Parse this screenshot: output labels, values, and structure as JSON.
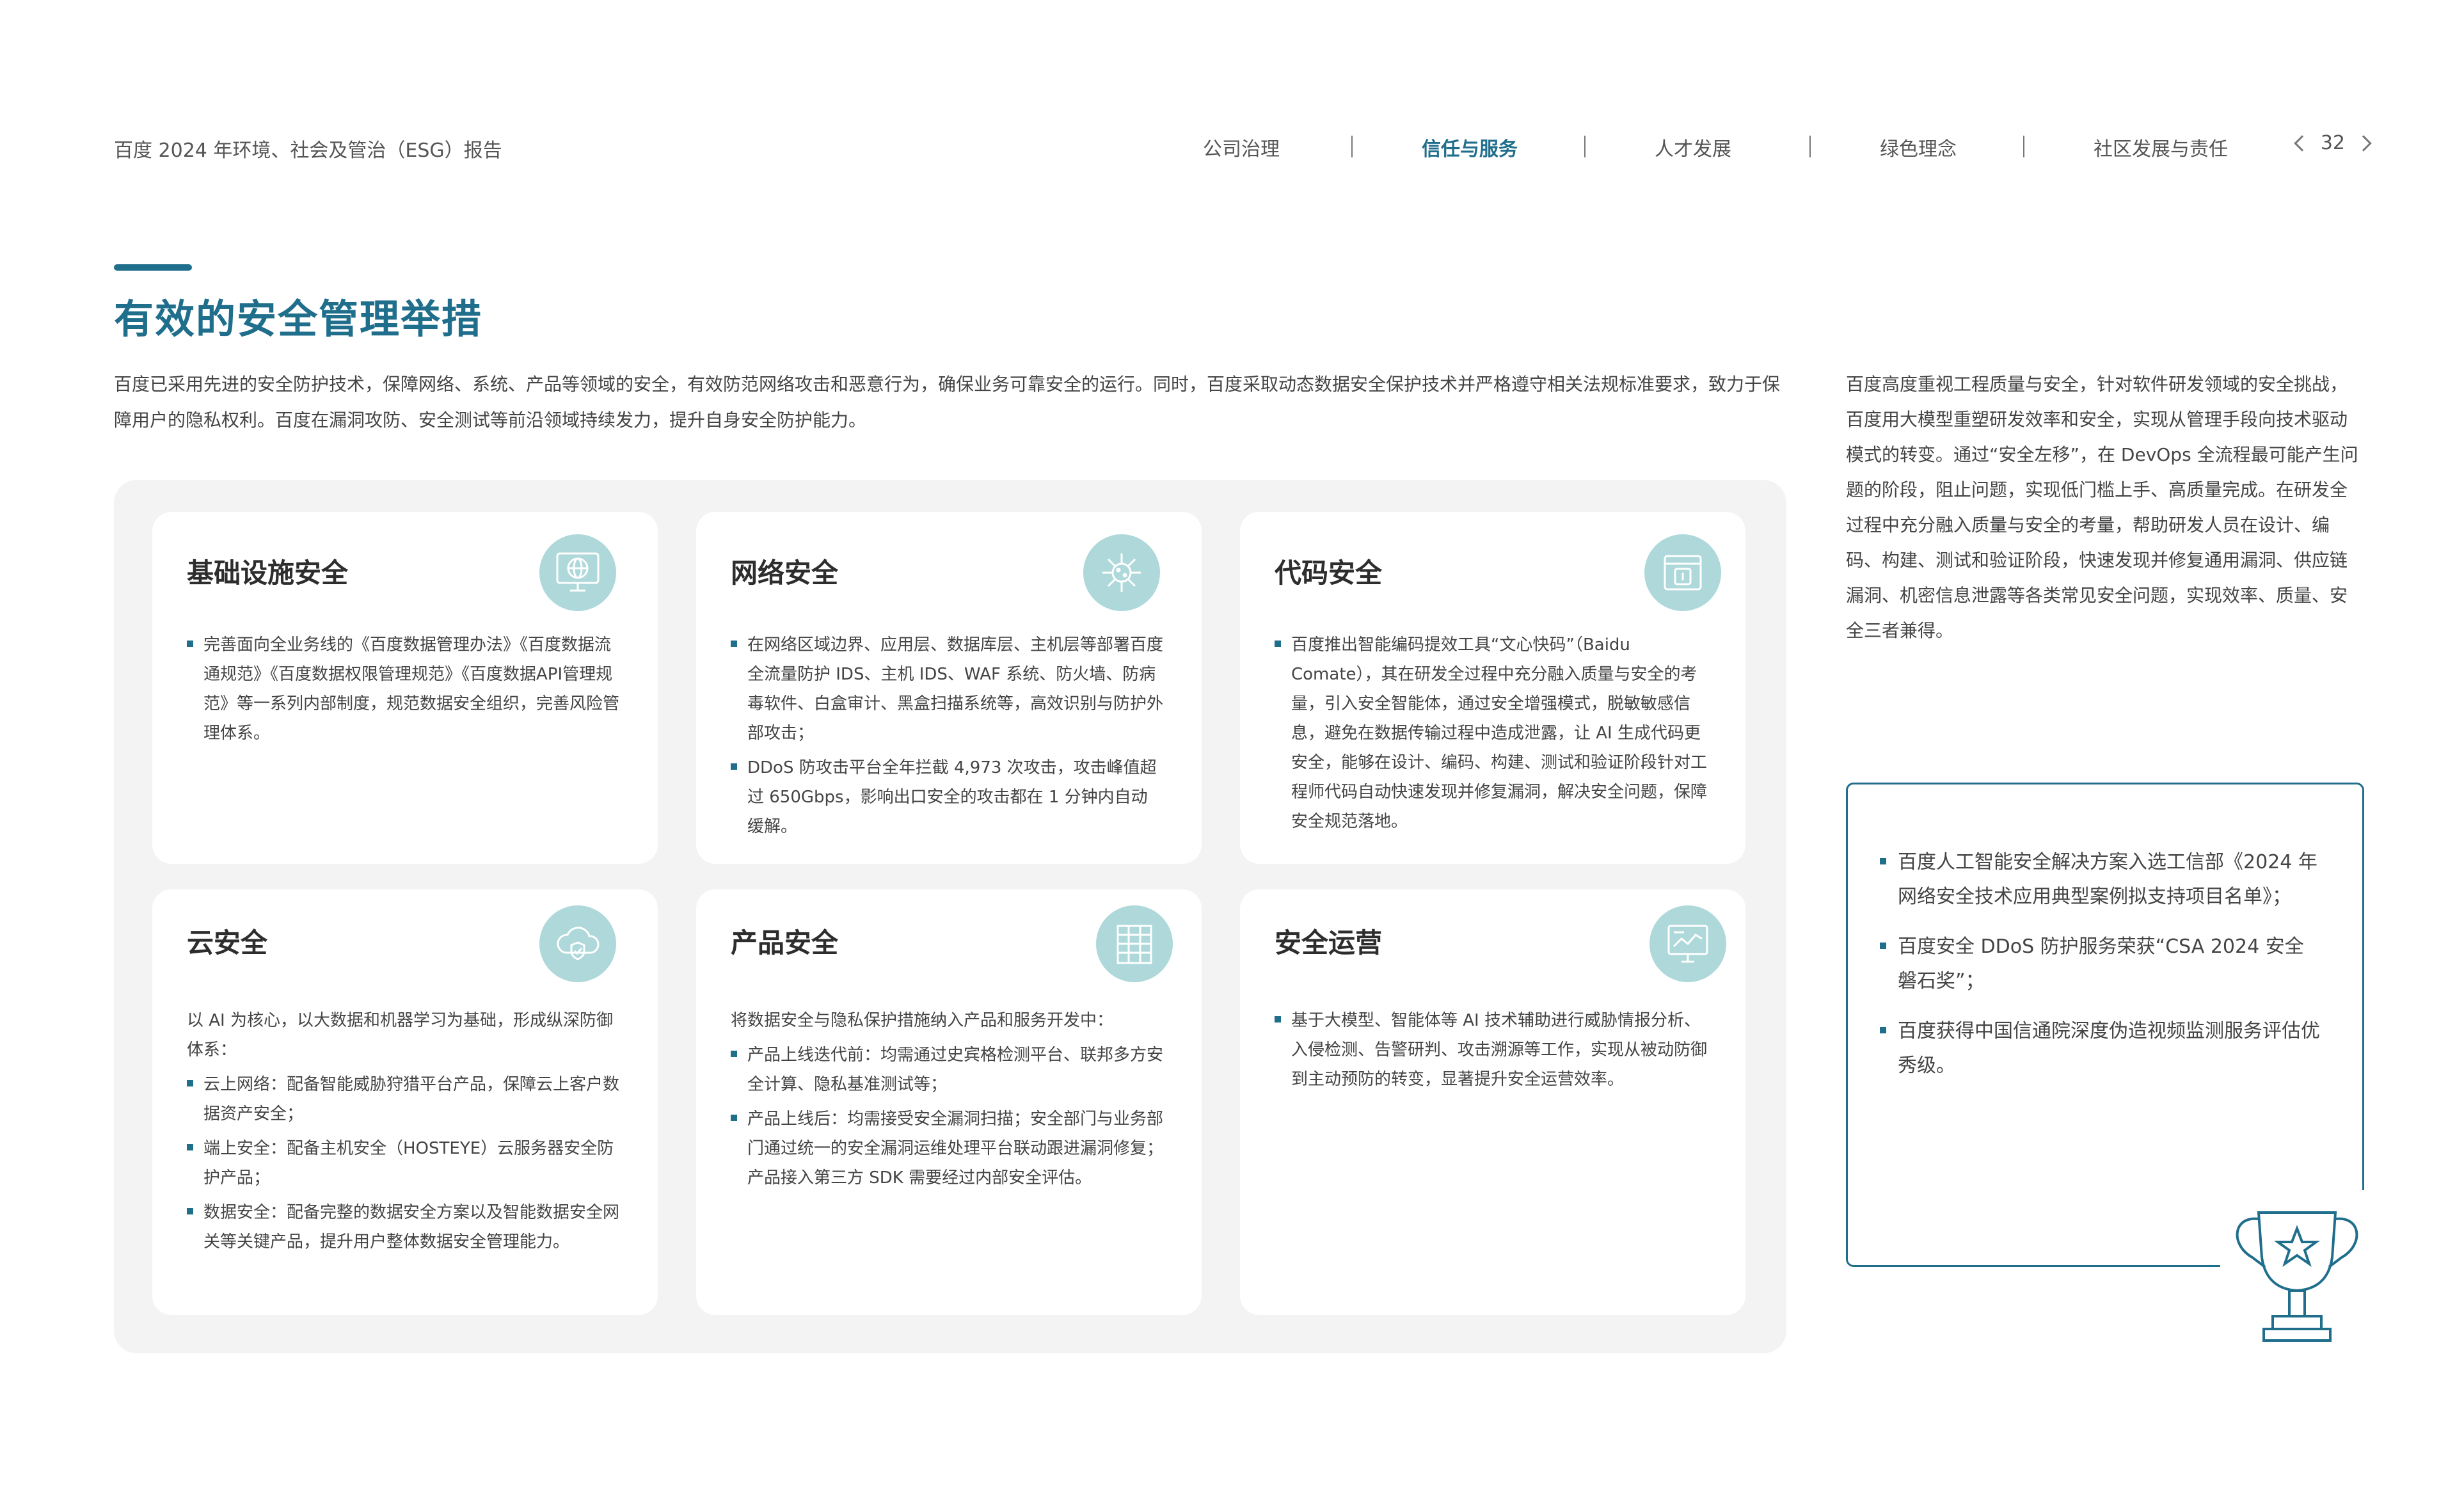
{
  "header": {
    "report_title": "百度 2024 年环境、社会及管治（ESG）报告",
    "nav": [
      {
        "label": "公司治理",
        "active": false
      },
      {
        "label": "信任与服务",
        "active": true
      },
      {
        "label": "人才发展",
        "active": false
      },
      {
        "label": "绿色理念",
        "active": false
      },
      {
        "label": "社区发展与责任",
        "active": false
      }
    ],
    "page_number": "32"
  },
  "section": {
    "title": "有效的安全管理举措",
    "intro": "百度已采用先进的安全防护技术，保障网络、系统、产品等领域的安全，有效防范网络攻击和恶意行为，确保业务可靠安全的运行。同时，百度采取动态数据安全保护技术并严格遵守相关法规标准要求，致力于保障用户的隐私权利。百度在漏洞攻防、安全测试等前沿领域持续发力，提升自身安全防护能力。",
    "side_text": "百度高度重视工程质量与安全，针对软件研发领域的安全挑战，百度用大模型重塑研发效率和安全，实现从管理手段向技术驱动模式的转变。通过“安全左移”，在 DevOps 全流程最可能产生问题的阶段，阻止问题，实现低门槛上手、高质量完成。在研发全过程中充分融入质量与安全的考量，帮助研发人员在设计、编码、构建、测试和验证阶段，快速发现并修复通用漏洞、供应链漏洞、机密信息泄露等各类常见安全问题，实现效率、质量、安全三者兼得。"
  },
  "cards": [
    {
      "title": "基础设施安全",
      "icon": "globe-monitor-icon",
      "intro": "",
      "bullets": [
        "完善面向全业务线的《百度数据管理办法》《百度数据流通规范》《百度数据权限管理规范》《百度数据API管理规范》等一系列内部制度，规范数据安全组织，完善风险管理体系。"
      ]
    },
    {
      "title": "网络安全",
      "icon": "virus-icon",
      "intro": "",
      "bullets": [
        "在网络区域边界、应用层、数据库层、主机层等部署百度全流量防护 IDS、主机 IDS、WAF 系统、防火墙、防病毒软件、白盒审计、黑盒扫描系统等，高效识别与防护外部攻击；",
        "DDoS 防攻击平台全年拦截 4,973 次攻击，攻击峰值超过 650Gbps，影响出口安全的攻击都在 1 分钟内自动缓解。"
      ]
    },
    {
      "title": "代码安全",
      "icon": "code-window-icon",
      "intro": "",
      "bullets": [
        "百度推出智能编码提效工具“文心快码”（Baidu Comate），其在研发全过程中充分融入质量与安全的考量，引入安全智能体，通过安全增强模式，脱敏敏感信息，避免在数据传输过程中造成泄露，让 AI 生成代码更安全，能够在设计、编码、构建、测试和验证阶段针对工程师代码自动快速发现并修复漏洞，解决安全问题，保障安全规范落地。"
      ]
    },
    {
      "title": "云安全",
      "icon": "cloud-shield-icon",
      "intro": "以 AI 为核心，以大数据和机器学习为基础，形成纵深防御体系：",
      "bullets": [
        "云上网络：配备智能威胁狩猎平台产品，保障云上客户数据资产安全；",
        "端上安全：配备主机安全（HOSTEYE）云服务器安全防护产品；",
        "数据安全：配备完整的数据安全方案以及智能数据安全网关等关键产品，提升用户整体数据安全管理能力。"
      ]
    },
    {
      "title": "产品安全",
      "icon": "building-icon",
      "intro": "将数据安全与隐私保护措施纳入产品和服务开发中：",
      "bullets": [
        "产品上线迭代前：均需通过史宾格检测平台、联邦多方安全计算、隐私基准测试等；",
        "产品上线后：均需接受安全漏洞扫描；安全部门与业务部门通过统一的安全漏洞运维处理平台联动跟进漏洞修复；产品接入第三方 SDK 需要经过内部安全评估。"
      ]
    },
    {
      "title": "安全运营",
      "icon": "monitor-chart-icon",
      "intro": "",
      "bullets": [
        "基于大模型、智能体等 AI 技术辅助进行威胁情报分析、入侵检测、告警研判、攻击溯源等工作，实现从被动防御到主动预防的转变，显著提升安全运营效率。"
      ]
    }
  ],
  "awards": [
    "百度人工智能安全解决方案入选工信部《2024 年网络安全技术应用典型案例拟支持项目名单》；",
    "百度安全 DDoS 防护服务荣获“CSA 2024 安全磐石奖”；",
    "百度获得中国信通院深度伪造视频监测服务评估优秀级。"
  ],
  "colors": {
    "accent": "#1f6e8c",
    "icon_bg": "#aed8da",
    "panel_bg": "#f3f3f3"
  }
}
